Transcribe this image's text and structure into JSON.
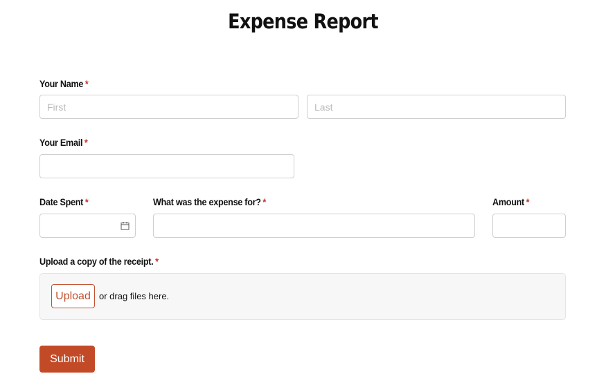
{
  "page": {
    "title": "Expense Report"
  },
  "required_marker": "*",
  "fields": {
    "name": {
      "label": "Your Name",
      "first_placeholder": "First",
      "last_placeholder": "Last",
      "first_value": "",
      "last_value": ""
    },
    "email": {
      "label": "Your Email",
      "value": ""
    },
    "date": {
      "label": "Date Spent",
      "value": "",
      "icon": "calendar-icon"
    },
    "expense": {
      "label": "What was the expense for?",
      "value": ""
    },
    "amount": {
      "label": "Amount",
      "value": ""
    },
    "receipt": {
      "label": "Upload a copy of the receipt.",
      "upload_label": "Upload",
      "drag_text": "or drag files here."
    }
  },
  "actions": {
    "submit_label": "Submit"
  },
  "colors": {
    "accent": "#c34a27",
    "required": "#c0392b"
  }
}
